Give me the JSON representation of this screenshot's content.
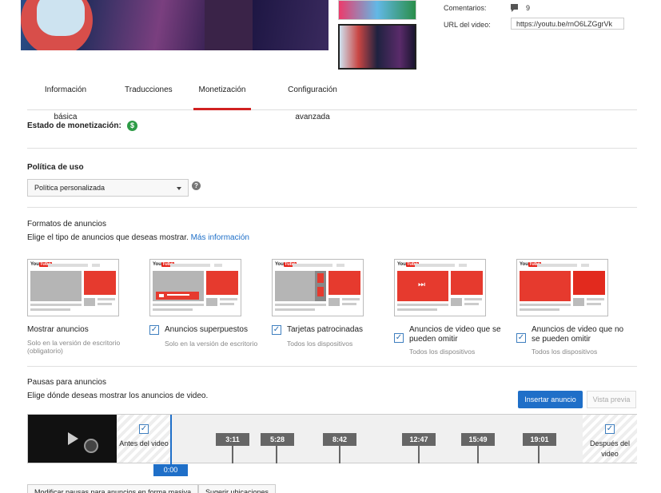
{
  "colors": {
    "accent": "#d12121",
    "primary": "#1f6fc8",
    "money": "#2d9b46"
  },
  "meta": {
    "comments_label": "Comentarios:",
    "comments_count": "9",
    "url_label": "URL del video:",
    "url_value": "https://youtu.be/rnO6LZGgrVk"
  },
  "tabs": [
    {
      "label": "Información básica"
    },
    {
      "label": "Traducciones"
    },
    {
      "label": "Monetización",
      "active": true
    },
    {
      "label": "Configuración avanzada"
    }
  ],
  "monetization_status": {
    "label": "Estado de monetización:",
    "icon": "dollar-icon"
  },
  "usage_policy": {
    "title": "Política de uso",
    "selected": "Política personalizada"
  },
  "ad_formats": {
    "title": "Formatos de anuncios",
    "subtitle": "Elige el tipo de anuncios que deseas mostrar.",
    "more_link": "Más información",
    "items": [
      {
        "label": "Mostrar anuncios",
        "sub": "Solo en la versión de escritorio (obligatorio)",
        "checked": false
      },
      {
        "label": "Anuncios superpuestos",
        "sub": "Solo en la versión de escritorio",
        "checked": true
      },
      {
        "label": "Tarjetas patrocinadas",
        "sub": "Todos los dispositivos",
        "checked": true
      },
      {
        "label": "Anuncios de video que se pueden omitir",
        "sub": "Todos los dispositivos",
        "checked": true
      },
      {
        "label": "Anuncios de video que no se pueden omitir",
        "sub": "Todos los dispositivos",
        "checked": true
      }
    ]
  },
  "ad_breaks": {
    "title": "Pausas para anuncios",
    "subtitle": "Elige dónde deseas mostrar los anuncios de video.",
    "insert_button": "Insertar anuncio",
    "preview_button": "Vista previa",
    "pre_roll": "Antes del video",
    "post_roll": "Después del video",
    "playhead_time": "0:00",
    "markers": [
      "3:11",
      "5:28",
      "8:42",
      "12:47",
      "15:49",
      "19:01"
    ],
    "bulk_edit_button": "Modificar pausas para anuncios en forma masiva",
    "suggest_button": "Sugerir ubicaciones"
  }
}
